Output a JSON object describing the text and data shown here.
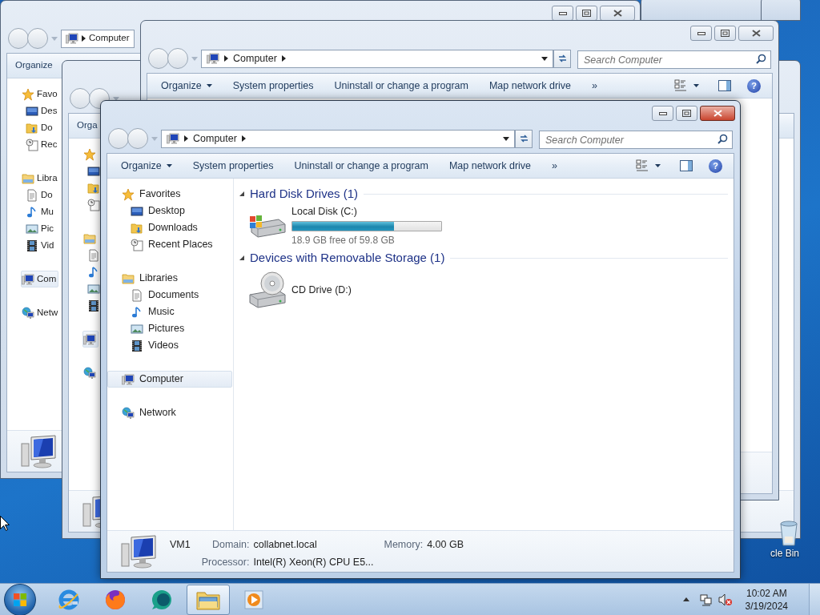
{
  "desktop": {
    "icons": [
      {
        "label": "cle Bin"
      }
    ]
  },
  "windows": [
    {
      "active": false,
      "address": [
        "Computer"
      ],
      "toolbar": [
        {
          "label": "Organize",
          "kind": "button"
        }
      ],
      "nav": [
        {
          "label": "Favo",
          "kind": "star",
          "selected": false,
          "children": [
            {
              "label": "Des",
              "kind": "desktop",
              "selected": false
            },
            {
              "label": "Do",
              "kind": "downloads",
              "selected": false
            },
            {
              "label": "Rec",
              "kind": "recent",
              "selected": false
            }
          ]
        },
        {
          "label": "Libra",
          "kind": "library",
          "selected": false,
          "children": [
            {
              "label": "Do",
              "kind": "documents",
              "selected": false
            },
            {
              "label": "Mu",
              "kind": "music",
              "selected": false
            },
            {
              "label": "Pic",
              "kind": "pictures",
              "selected": false
            },
            {
              "label": "Vid",
              "kind": "videos",
              "selected": false
            }
          ]
        },
        {
          "label": "Com",
          "kind": "computer",
          "selected": true
        },
        {
          "label": "Netw",
          "kind": "network",
          "selected": false
        }
      ]
    },
    {
      "active": false,
      "toolbar": [
        {
          "label": "Orga",
          "kind": "button"
        }
      ],
      "nav": [
        {
          "kind": "star",
          "selected": false,
          "children": [
            {
              "kind": "desktop",
              "selected": false
            },
            {
              "kind": "downloads",
              "selected": false
            },
            {
              "kind": "recent",
              "selected": false
            }
          ]
        },
        {
          "kind": "library",
          "selected": false,
          "children": [
            {
              "kind": "documents",
              "selected": false
            },
            {
              "kind": "music",
              "selected": false
            },
            {
              "kind": "pictures",
              "selected": false
            },
            {
              "kind": "videos",
              "selected": false
            }
          ]
        },
        {
          "kind": "computer",
          "selected": true
        },
        {
          "kind": "network",
          "selected": false
        }
      ]
    },
    {
      "active": false,
      "address": [
        "Computer"
      ],
      "placeholder": "Search Computer",
      "help": "?",
      "toolbar": [
        {
          "label": "Organize",
          "kind": "menu"
        },
        {
          "label": "System properties",
          "kind": "button"
        },
        {
          "label": "Uninstall or change a program",
          "kind": "button"
        },
        {
          "label": "Map network drive",
          "kind": "button"
        },
        {
          "label": "»",
          "kind": "button"
        }
      ]
    },
    {
      "active": true,
      "address": [
        "Computer"
      ],
      "placeholder": "Search Computer",
      "help": "?",
      "toolbar": [
        {
          "label": "Organize",
          "kind": "menu"
        },
        {
          "label": "System properties",
          "kind": "button"
        },
        {
          "label": "Uninstall or change a program",
          "kind": "button"
        },
        {
          "label": "Map network drive",
          "kind": "button"
        },
        {
          "label": "»",
          "kind": "button"
        }
      ],
      "nav": [
        {
          "label": "Favorites",
          "kind": "star",
          "selected": false,
          "children": [
            {
              "label": "Desktop",
              "kind": "desktop",
              "selected": false
            },
            {
              "label": "Downloads",
              "kind": "downloads",
              "selected": false
            },
            {
              "label": "Recent Places",
              "kind": "recent",
              "selected": false
            }
          ]
        },
        {
          "label": "Libraries",
          "kind": "library",
          "selected": false,
          "children": [
            {
              "label": "Documents",
              "kind": "documents",
              "selected": false
            },
            {
              "label": "Music",
              "kind": "music",
              "selected": false
            },
            {
              "label": "Pictures",
              "kind": "pictures",
              "selected": false
            },
            {
              "label": "Videos",
              "kind": "videos",
              "selected": false
            }
          ]
        },
        {
          "label": "Computer",
          "kind": "computer",
          "selected": true
        },
        {
          "label": "Network",
          "kind": "network",
          "selected": false
        }
      ],
      "sections": [
        {
          "title": "Hard Disk Drives (1)",
          "items": [
            {
              "kind": "disk",
              "name": "Local Disk (C:)",
              "level": 0.684,
              "detail": "18.9 GB free of 59.8 GB"
            }
          ]
        },
        {
          "title": "Devices with Removable Storage (1)",
          "items": [
            {
              "kind": "cd",
              "name": "CD Drive (D:)"
            }
          ]
        }
      ],
      "status": {
        "name": "VM1",
        "fields": [
          {
            "label": "Domain:",
            "value": "collabnet.local"
          },
          {
            "label": "Memory:",
            "value": "4.00 GB"
          },
          {
            "label": "Processor:",
            "value": "Intel(R) Xeon(R) CPU E5..."
          }
        ]
      }
    }
  ],
  "taskbar": {
    "apps": [
      {
        "kind": "ie",
        "selected": false
      },
      {
        "kind": "firefox",
        "selected": false
      },
      {
        "kind": "chat",
        "selected": false
      },
      {
        "kind": "explorer",
        "selected": true
      },
      {
        "kind": "media",
        "selected": false
      }
    ],
    "time": "10:02 AM",
    "date": "3/19/2024"
  }
}
